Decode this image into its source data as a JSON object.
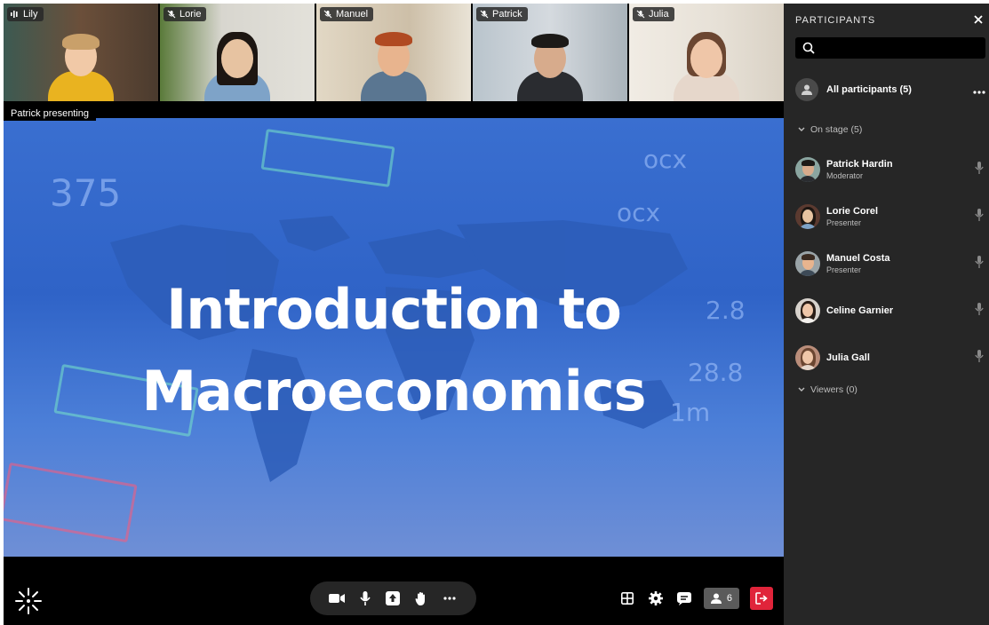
{
  "thumbnails": [
    {
      "name": "Lily",
      "icon": "speaking-icon",
      "bg": "#5b4a3a",
      "hair": "#c9a06a",
      "skin": "#f1c9a7",
      "shirt": "#e9b320"
    },
    {
      "name": "Lorie",
      "icon": "mic-muted-icon",
      "bg": "#d8d6cf",
      "hair": "#1d1612",
      "skin": "#e7c3a1",
      "shirt": "#7ea3c8"
    },
    {
      "name": "Manuel",
      "icon": "mic-muted-icon",
      "bg": "#cfc4b0",
      "hair": "#b04a22",
      "skin": "#e8b48e",
      "shirt": "#5a7691"
    },
    {
      "name": "Patrick",
      "icon": "mic-muted-icon",
      "bg": "#c7ced4",
      "hair": "#1c1a18",
      "skin": "#d7ab8c",
      "shirt": "#2a2c30"
    },
    {
      "name": "Julia",
      "icon": "mic-muted-icon",
      "bg": "#ece7e0",
      "hair": "#6b4631",
      "skin": "#efc6a8",
      "shirt": "#e6d7cb"
    }
  ],
  "presenting_label": "Patrick presenting",
  "slide": {
    "title_line1": "Introduction to",
    "title_line2": "Macroeconomics"
  },
  "controls": {
    "center": [
      "camera-icon",
      "mic-icon",
      "share-screen-icon",
      "raise-hand-icon",
      "more-icon"
    ],
    "participants_count": "6"
  },
  "panel": {
    "title": "PARTICIPANTS",
    "all_participants": "All participants (5)",
    "on_stage": "On stage (5)",
    "viewers": "Viewers (0)",
    "participants": [
      {
        "name": "Patrick Hardin",
        "role": "Moderator",
        "skin": "#d7ab8c",
        "hair": "#1c1a18",
        "bg": "#8aa5a0"
      },
      {
        "name": "Lorie Corel",
        "role": "Presenter",
        "skin": "#e7c3a1",
        "hair": "#1d1612",
        "bg": "#5b3a30"
      },
      {
        "name": "Manuel Costa",
        "role": "Presenter",
        "skin": "#e8b48e",
        "hair": "#3a2a20",
        "bg": "#9aa4a8"
      },
      {
        "name": "Celine Garnier",
        "role": "",
        "skin": "#efc6a8",
        "hair": "#2a1d16",
        "bg": "#d7d2cc"
      },
      {
        "name": "Julia Gall",
        "role": "",
        "skin": "#efc6a8",
        "hair": "#6b4631",
        "bg": "#b98d7a"
      }
    ]
  }
}
